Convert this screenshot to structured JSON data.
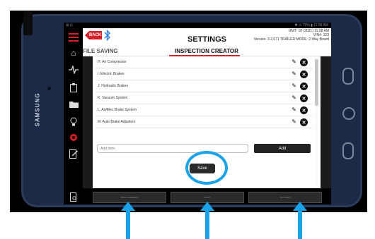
{
  "status_bar": {
    "left": "⊞ ⊡",
    "right": "✱ ⊙ 79% ▮ 11:08 AM"
  },
  "header": {
    "back_label": "BACK",
    "title": "SETTINGS",
    "info_line1": "UNIT: 18 (2021) 11:08 AM",
    "info_line2": "VIN#: 123",
    "info_line3": "Version: 3.2.671 TRAILER MODE: 2 Way Board"
  },
  "tabs": {
    "file_saving": "FILE SAVING",
    "inspection_creator": "INSPECTION CREATOR"
  },
  "inspection_items": [
    {
      "label": "H. Air Compressor"
    },
    {
      "label": "I. Electric Brakes"
    },
    {
      "label": "J. Hydraulic Brakes"
    },
    {
      "label": "K. Vacuum System"
    },
    {
      "label": "L. Air/Elec Brake System"
    },
    {
      "label": "M. Auto Brake Adjustors"
    }
  ],
  "add_item": {
    "placeholder": "Add Item",
    "button_label": "Add"
  },
  "save_label": "Save",
  "bottom_nav": {
    "item1": "SEND CARRIERS",
    "item2": "PRINT",
    "item3": "SETTINGS"
  },
  "device_brand": "SAMSUNG",
  "colors": {
    "accent_red": "#d51f26",
    "highlight_blue": "#1aa3e8",
    "bluetooth_blue": "#2a7de1"
  },
  "icons": {
    "sidebar": [
      "menu-icon",
      "home-icon",
      "heartbeat-icon",
      "clipboard-icon",
      "folder-icon",
      "lightbulb-icon",
      "gear-icon",
      "edit-icon",
      "document-search-icon"
    ],
    "header": [
      "back-arrow-icon",
      "bluetooth-icon"
    ],
    "rows": [
      "pencil-icon",
      "delete-icon"
    ]
  }
}
